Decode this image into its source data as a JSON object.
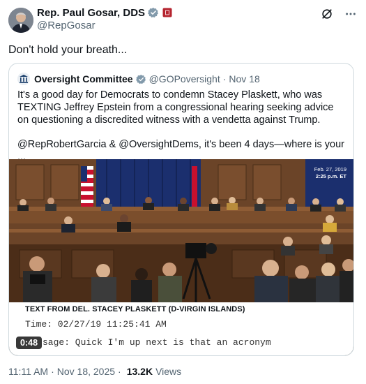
{
  "author": {
    "display_name": "Rep. Paul Gosar, DDS",
    "handle": "@RepGosar",
    "verified_icon": "verified-gray-check",
    "badge_icon": "flag-badge"
  },
  "tweet": {
    "text": "Don't hold your breath..."
  },
  "quote": {
    "name": "Oversight Committee",
    "handle": "@GOPoversight",
    "separator": "·",
    "date": "Nov 18",
    "paragraph1": "It's a good day for Democrats to condemn Stacey Plaskett, who was TEXTING Jeffrey Epstein from a congressional hearing seeking advice on questioning a discredited witness with a vendetta against Trump.",
    "paragraph2": "@RepRobertGarcia & @OversightDems, it's been 4 days—where is your ..."
  },
  "media": {
    "timestamp_date": "Feb. 27, 2019",
    "timestamp_time": "2:25 p.m. ET",
    "caption_title": "TEXT FROM DEL. STACEY PLASKETT (D-VIRGIN ISLANDS)",
    "caption_time": "Time: 02/27/19 11:25:41 AM",
    "caption_message": "sage: Quick I'm up next is that an acronym",
    "duration": "0:48"
  },
  "meta": {
    "time": "11:11 AM",
    "dot": "·",
    "date": "Nov 18, 2025",
    "views_count": "13.2K",
    "views_label": "Views"
  },
  "colors": {
    "text": "#0f1419",
    "secondary": "#536471",
    "border": "#cfd9de",
    "verified_gray": "#829aab"
  }
}
